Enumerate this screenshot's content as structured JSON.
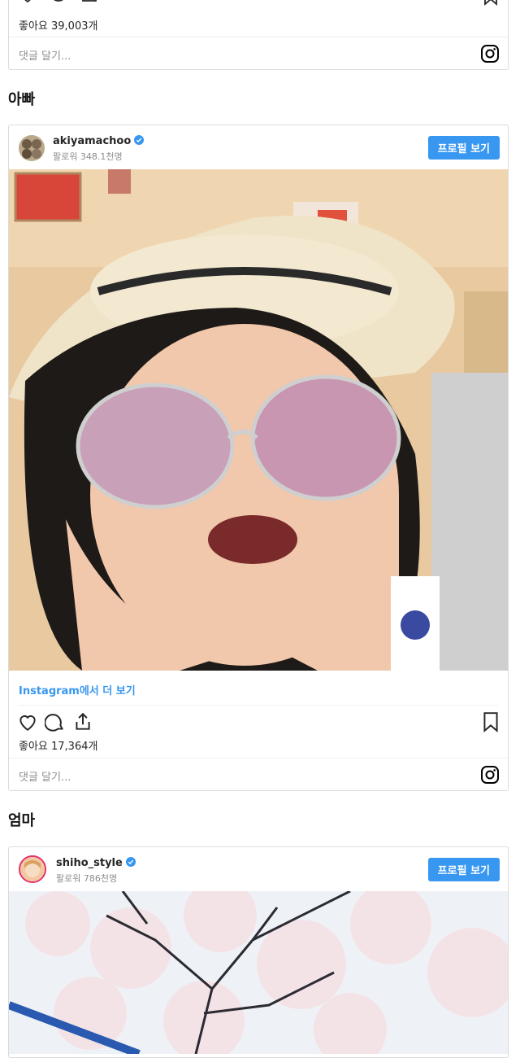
{
  "top_post": {
    "likes": "좋아요 39,003개",
    "comment_placeholder": "댓글 달기..."
  },
  "section_dad": {
    "title": "아빠"
  },
  "post_dad": {
    "username": "akiyamachoo",
    "followers": "팔로워 348.1천명",
    "profile_button": "프로필 보기",
    "more_link": "Instagram에서 더 보기",
    "likes": "좋아요 17,364개",
    "comment_placeholder": "댓글 달기..."
  },
  "section_mom": {
    "title": "엄마"
  },
  "post_mom": {
    "username": "shiho_style",
    "followers": "팔로워 786천명",
    "profile_button": "프로필 보기"
  },
  "colors": {
    "accent": "#3897f0",
    "border": "#dbdbdb",
    "muted": "#8e8e8e"
  },
  "icons": [
    "heart-icon",
    "comment-icon",
    "share-icon",
    "bookmark-icon",
    "instagram-icon",
    "verified-badge-icon"
  ]
}
